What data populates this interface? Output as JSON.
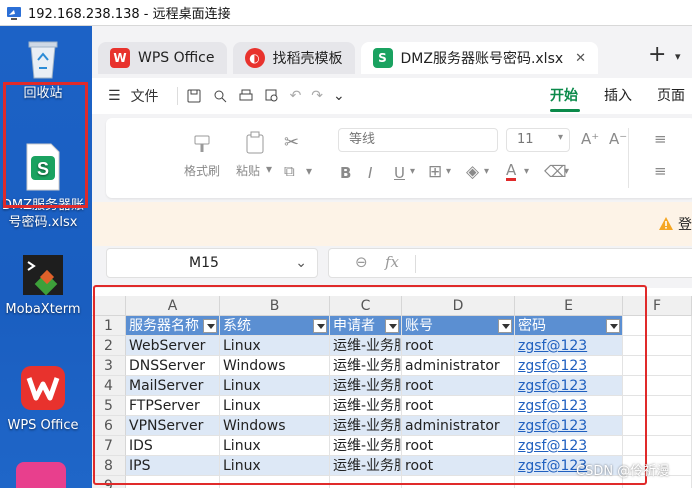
{
  "rdp": {
    "title": "192.168.238.138 - 远程桌面连接"
  },
  "desktop": {
    "items": [
      {
        "label": "回收站",
        "icon": "recycle-bin-icon"
      },
      {
        "label": "DMZ服务器账号密码.xlsx",
        "icon": "spreadsheet-file-icon"
      },
      {
        "label": "MobaXterm",
        "icon": "mobaxterm-icon"
      },
      {
        "label": "WPS Office",
        "icon": "wps-office-icon"
      }
    ],
    "partial_label": "口",
    "partial_label2": "账"
  },
  "tabs": [
    {
      "label": "WPS Office",
      "icon": "wps-logo-icon",
      "color": "#e8322d"
    },
    {
      "label": "找稻壳模板",
      "icon": "docer-icon",
      "color": "#e8322d"
    },
    {
      "label": "DMZ服务器账号密码.xlsx",
      "icon": "sheet-s-icon",
      "color": "#1aa260",
      "active": true
    }
  ],
  "menu": {
    "file": "文件",
    "start": "开始",
    "insert": "插入",
    "page": "页面"
  },
  "ribbon": {
    "format_painter": "格式刷",
    "paste": "粘贴",
    "font": "等线",
    "size": "11"
  },
  "notice": {
    "text": "登"
  },
  "formula": {
    "cell_ref": "M15",
    "fx": "fx"
  },
  "sheet": {
    "columns": [
      "A",
      "B",
      "C",
      "D",
      "E",
      "F"
    ],
    "rows": [
      "1",
      "2",
      "3",
      "4",
      "5",
      "6",
      "7",
      "8",
      "9"
    ],
    "header": [
      "服务器名称",
      "系统",
      "申请者",
      "账号",
      "密码"
    ],
    "data": [
      [
        "WebServer",
        "Linux",
        "运维-业务服务器",
        "root",
        "zgsf@123"
      ],
      [
        "DNSServer",
        "Windows",
        "运维-业务服务器",
        "administrator",
        "zgsf@123"
      ],
      [
        "MailServer",
        "Linux",
        "运维-业务服务器",
        "root",
        "zgsf@123"
      ],
      [
        "FTPServer",
        "Linux",
        "运维-业务服务器",
        "root",
        "zgsf@123"
      ],
      [
        "VPNServer",
        "Windows",
        "运维-业务服务器",
        "administrator",
        "zgsf@123"
      ],
      [
        "IDS",
        "Linux",
        "运维-业务服务器",
        "root",
        "zgsf@123"
      ],
      [
        "IPS",
        "Linux",
        "运维-业务服务器",
        "root",
        "zgsf@123"
      ]
    ]
  },
  "watermark": "CSDN @伶祈漫",
  "colors": {
    "accent": "#0b8a4a",
    "table_header": "#5b8fd2",
    "table_band": "#dde8f6",
    "highlight": "#e02a2a"
  }
}
